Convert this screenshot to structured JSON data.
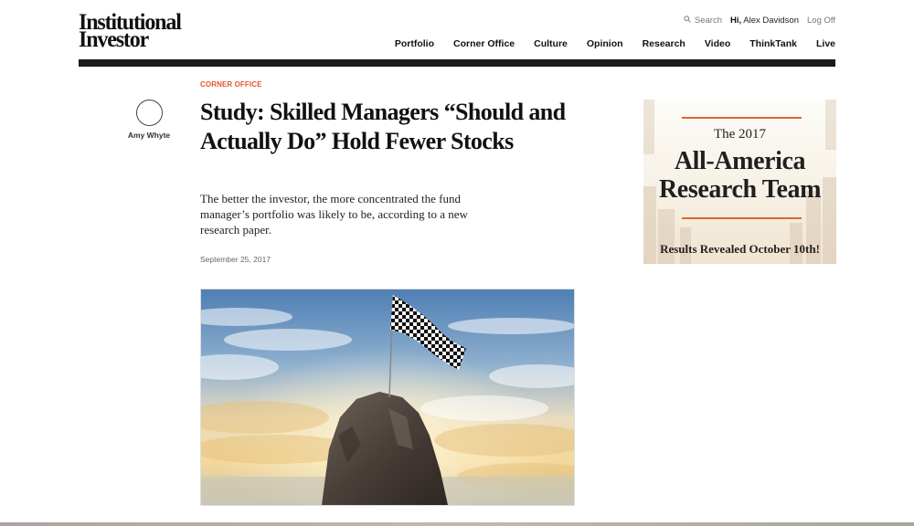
{
  "header": {
    "logo": [
      "Institutional",
      "Investor"
    ],
    "utility": {
      "search_label": "Search",
      "greeting": "Hi,",
      "user_name": "Alex Davidson",
      "logoff_label": "Log Off"
    },
    "nav": [
      "Portfolio",
      "Corner Office",
      "Culture",
      "Opinion",
      "Research",
      "Video",
      "ThinkTank",
      "Live"
    ]
  },
  "article": {
    "author": {
      "name": "Amy Whyte"
    },
    "kicker": "CORNER OFFICE",
    "headline": "Study: Skilled Managers “Should and Actually Do” Hold Fewer Stocks",
    "dek": "The better the investor, the more concentrated the fund manager’s portfolio was likely to be, according to a new research paper.",
    "date": "September 25, 2017"
  },
  "ad": {
    "year_line": "The 2017",
    "title_lines": [
      "All-America",
      "Research Team"
    ],
    "tagline": "Results Revealed October 10th!"
  },
  "colors": {
    "kicker": "#e4572e",
    "ad_accent": "#e0662e",
    "header_rule": "#1b1b1b"
  },
  "icons": {
    "search": "search-icon"
  }
}
